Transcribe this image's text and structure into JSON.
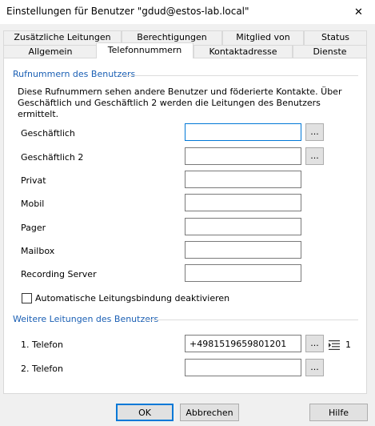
{
  "window": {
    "title": "Einstellungen für Benutzer \"gdud@estos-lab.local\"",
    "close_glyph": "✕"
  },
  "tabs": {
    "row1": [
      "Zusätzliche Leitungen",
      "Berechtigungen",
      "Mitglied von",
      "Status"
    ],
    "row2": [
      "Allgemein",
      "Telefonnummern",
      "Kontaktadresse",
      "Dienste"
    ],
    "active": "Telefonnummern"
  },
  "numbers_section": {
    "title": "Rufnummern des Benutzers",
    "description": "Diese Rufnummern sehen andere Benutzer und föderierte Kontakte. Über Geschäftlich und Geschäftlich 2 werden die Leitungen des Benutzers ermittelt.",
    "fields": [
      {
        "label": "Geschäftlich",
        "value": "",
        "browse": true
      },
      {
        "label": "Geschäftlich 2",
        "value": "",
        "browse": true
      },
      {
        "label": "Privat",
        "value": ""
      },
      {
        "label": "Mobil",
        "value": ""
      },
      {
        "label": "Pager",
        "value": ""
      },
      {
        "label": "Mailbox",
        "value": ""
      },
      {
        "label": "Recording Server",
        "value": ""
      }
    ],
    "checkbox_label": "Automatische Leitungsbindung deaktivieren",
    "checkbox_checked": false
  },
  "lines_section": {
    "title": "Weitere Leitungen des Benutzers",
    "lines": [
      {
        "label": "1. Telefon",
        "value": "+4981519659801201",
        "count": "1"
      },
      {
        "label": "2. Telefon",
        "value": ""
      }
    ]
  },
  "browse_label": "...",
  "icons": {
    "list": "list-icon",
    "close": "close-icon"
  },
  "buttons": {
    "ok": "OK",
    "cancel": "Abbrechen",
    "help": "Hilfe"
  },
  "colors": {
    "section_title": "#1a5fb4",
    "focus": "#0078d7"
  }
}
